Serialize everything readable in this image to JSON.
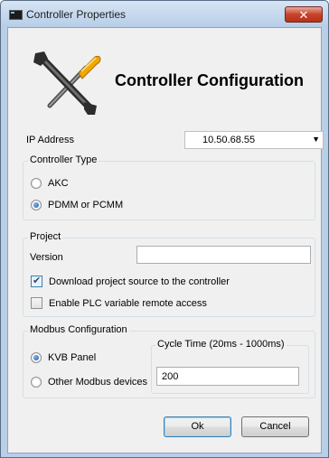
{
  "window": {
    "title": "Controller Properties",
    "close_label": "✕"
  },
  "header": {
    "title": "Controller Configuration",
    "icon": "wrench-screwdriver-icon"
  },
  "ip": {
    "label": "IP Address",
    "value": "10.50.68.55",
    "arrow": "▼"
  },
  "controller_type": {
    "group_title": "Controller Type",
    "options": [
      {
        "label": "AKC",
        "selected": false
      },
      {
        "label": "PDMM or PCMM",
        "selected": true
      }
    ]
  },
  "project": {
    "group_title": "Project",
    "version_label": "Version",
    "version_value": "",
    "download_source": {
      "label": "Download project source to the controller",
      "checked": true
    },
    "plc_remote": {
      "label": "Enable PLC variable remote access",
      "checked": false
    }
  },
  "modbus": {
    "group_title": "Modbus Configuration",
    "options": [
      {
        "label": "KVB Panel",
        "selected": true
      },
      {
        "label": "Other Modbus devices",
        "selected": false
      }
    ],
    "cycle_title": "Cycle Time (20ms - 1000ms)",
    "cycle_value": "200"
  },
  "buttons": {
    "ok": "Ok",
    "cancel": "Cancel"
  },
  "colors": {
    "titlebar": "#c4d8ef",
    "close": "#c8432b",
    "client": "#f0f0f0",
    "radio_dot": "#1f5fb1"
  }
}
